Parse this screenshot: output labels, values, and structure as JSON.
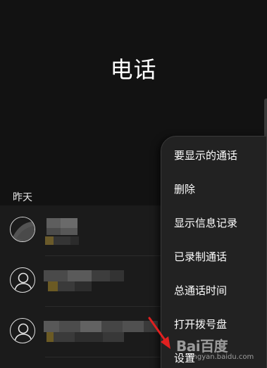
{
  "header": {
    "title": "电话"
  },
  "recents": {
    "section_label": "昨天",
    "rows": [
      {
        "avatar": "contact-photo-blurred"
      },
      {
        "avatar": "default-person-icon"
      },
      {
        "avatar": "default-person-icon"
      }
    ]
  },
  "overflow_menu": {
    "items": [
      {
        "label": "要显示的通话"
      },
      {
        "label": "删除"
      },
      {
        "label": "显示信息记录"
      },
      {
        "label": "已录制通话"
      },
      {
        "label": "总通话时间"
      },
      {
        "label": "打开拨号盘"
      },
      {
        "label": "设置"
      }
    ]
  },
  "watermark": {
    "logo_text": "Bai百度",
    "sub_text": "jingyan.baidu.com"
  },
  "colors": {
    "background": "#121212",
    "list_background": "#1b1b1b",
    "menu_background": "#222222",
    "annotation_arrow": "#e02020",
    "text": "#ffffff"
  },
  "icons": {
    "avatar_default": "person-icon",
    "annotation": "red-arrow"
  }
}
